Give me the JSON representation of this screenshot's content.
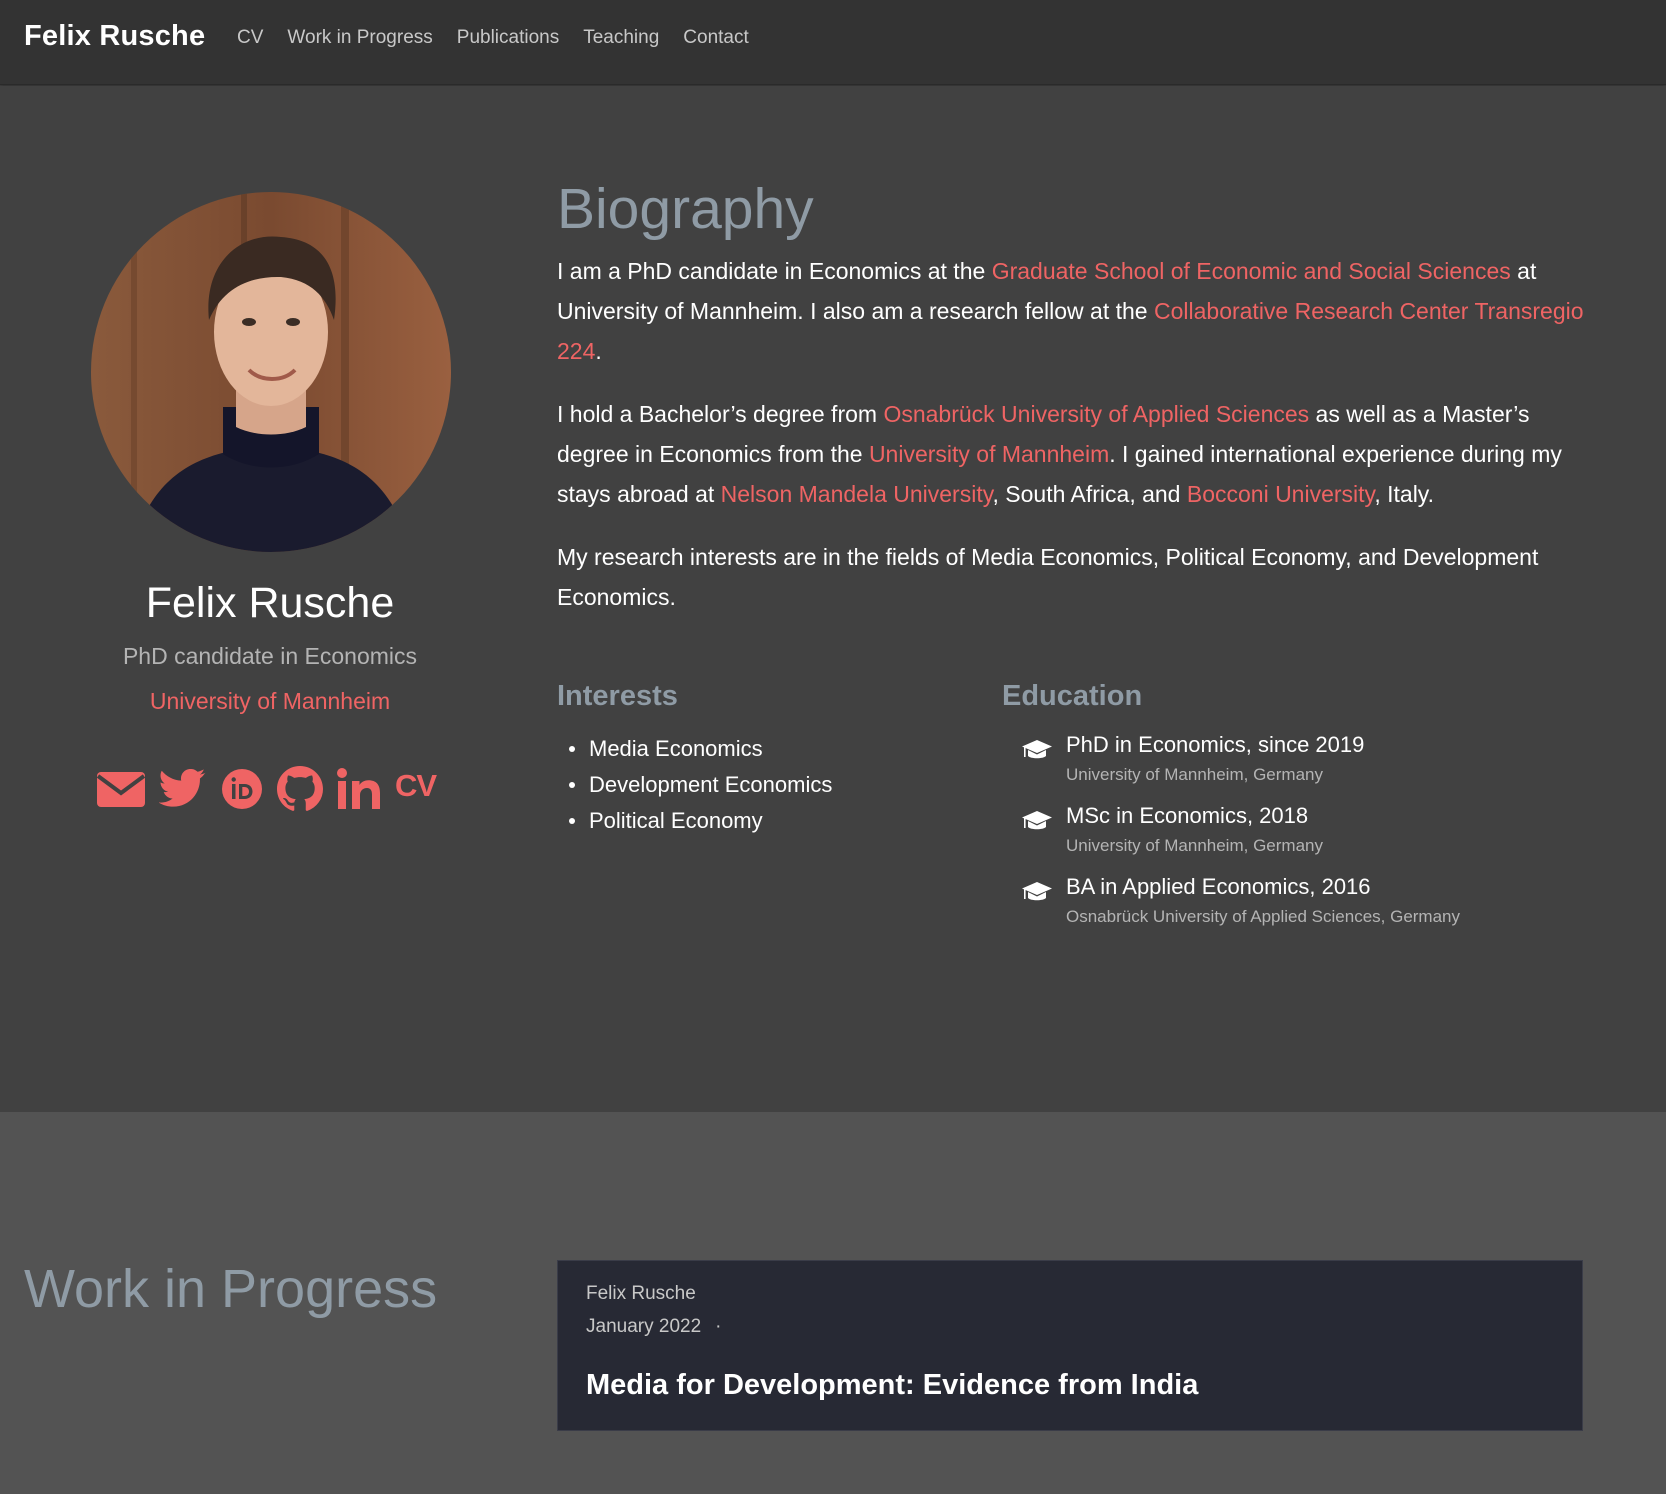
{
  "navbar": {
    "brand": "Felix Rusche",
    "links": [
      "CV",
      "Work in Progress",
      "Publications",
      "Teaching",
      "Contact"
    ]
  },
  "profile": {
    "name": "Felix Rusche",
    "role": "PhD candidate in Economics",
    "organization": "University of Mannheim",
    "social_icons": [
      "envelope-icon",
      "twitter-icon",
      "orcid-icon",
      "github-icon",
      "linkedin-icon",
      "cv-icon"
    ],
    "cv_label": "CV"
  },
  "biography": {
    "title": "Biography",
    "p1": {
      "t1": "I am a PhD candidate in Economics at the ",
      "link1": "Graduate School of Economic and Social Sciences",
      "t2": " at University of Mannheim. I also am a research fellow at the ",
      "link2": "Collaborative Research Center Transregio 224",
      "t3": "."
    },
    "p2": {
      "t1": "I hold a Bachelor’s degree from ",
      "link1": "Osnabrück University of Applied Sciences",
      "t2": " as well as a Master’s degree in Economics from the ",
      "link2": "University of Mannheim",
      "t3": ". I gained international experience during my stays abroad at ",
      "link3": "Nelson Mandela University",
      "t4": ", South Africa, and ",
      "link4": "Bocconi University",
      "t5": ", Italy."
    },
    "p3": "My research interests are in the fields of Media Economics, Political Economy, and Development Economics."
  },
  "interests": {
    "title": "Interests",
    "items": [
      "Media Economics",
      "Development Economics",
      "Political Economy"
    ]
  },
  "education": {
    "title": "Education",
    "items": [
      {
        "course": "PhD in Economics, since 2019",
        "institution": "University of Mannheim, Germany"
      },
      {
        "course": "MSc in Economics, 2018",
        "institution": "University of Mannheim, Germany"
      },
      {
        "course": "BA in Applied Economics, 2016",
        "institution": "Osnabrück University of Applied Sciences, Germany"
      }
    ]
  },
  "work_in_progress": {
    "title": "Work in Progress",
    "card": {
      "author": "Felix Rusche",
      "date": "January 2022",
      "separator": "·",
      "title": "Media for Development: Evidence from India"
    }
  },
  "colors": {
    "accent": "#ef6464",
    "background": "#414141",
    "navbar": "#333333",
    "heading": "#8f9ba5",
    "card": "#272934"
  }
}
